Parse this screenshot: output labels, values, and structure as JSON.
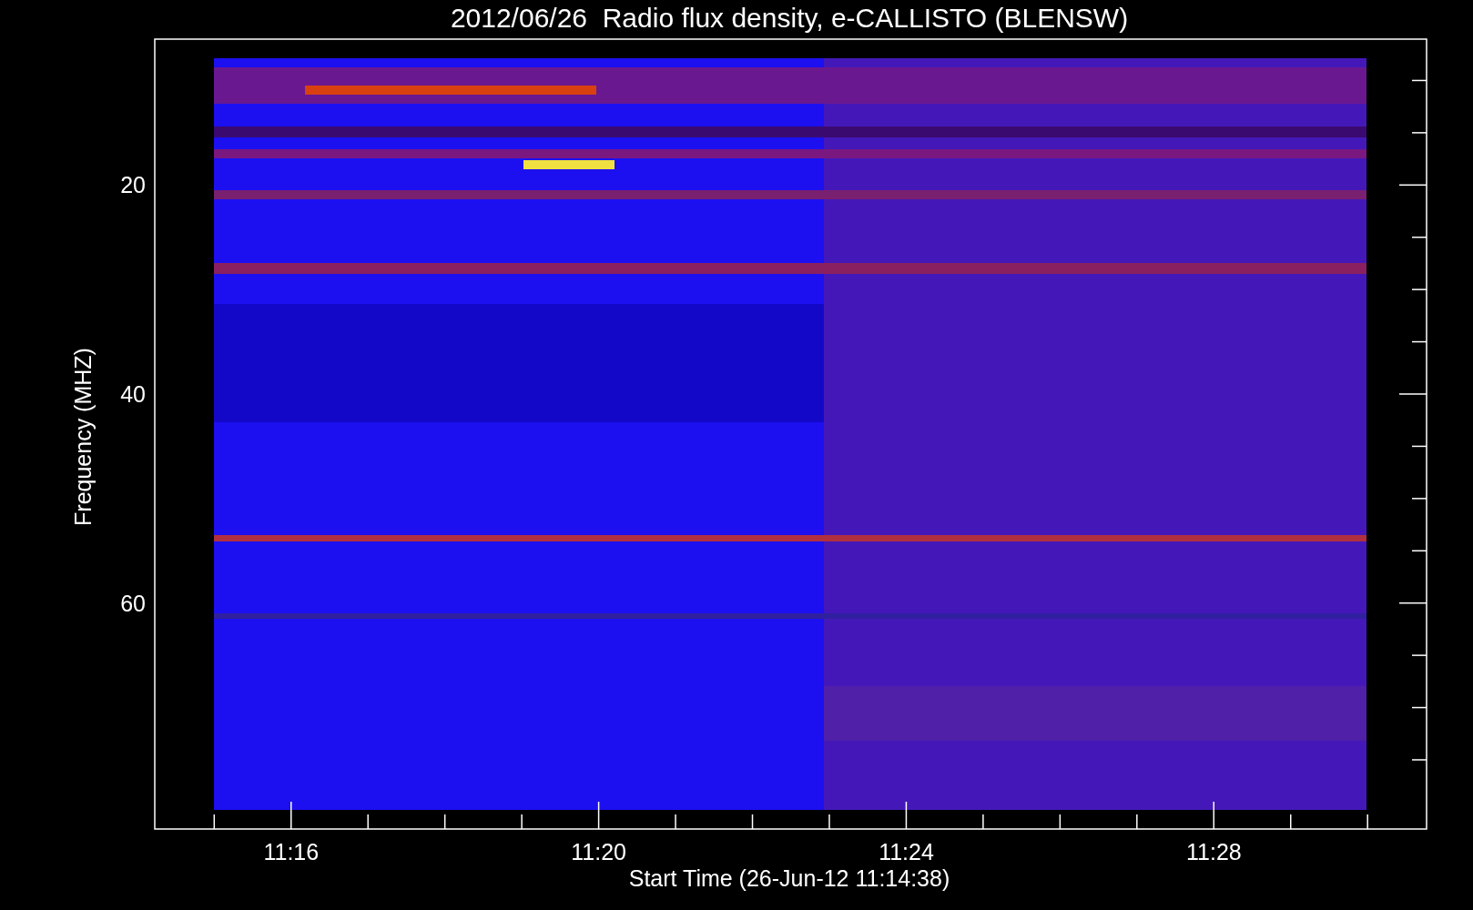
{
  "title": "2012/06/26  Radio flux density, e-CALLISTO (BLENSW)",
  "y_axis": {
    "label": "Frequency (MHZ)",
    "ticks": [
      "20",
      "40",
      "60"
    ]
  },
  "x_axis": {
    "label": "Start Time (26-Jun-12 11:14:38)",
    "ticks": [
      "11:16",
      "11:20",
      "11:24",
      "11:28"
    ]
  }
}
